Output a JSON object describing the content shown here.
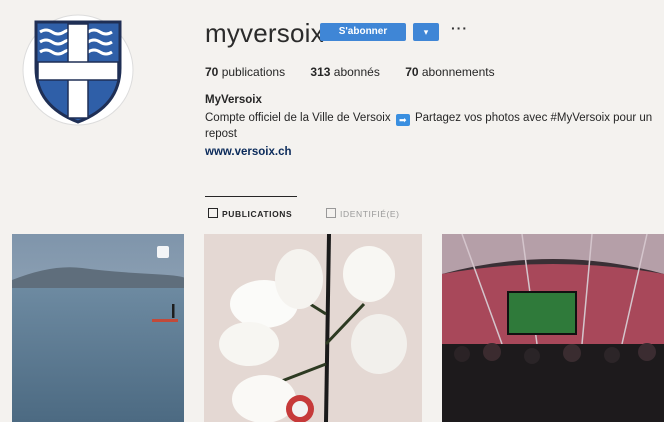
{
  "profile": {
    "username": "myversoix",
    "follow_label": "S'abonner",
    "dropdown_glyph": "▾",
    "more_glyph": "···",
    "stats": {
      "posts": "70",
      "posts_label": " publications",
      "followers": "313",
      "followers_label": " abonnés",
      "following": "70",
      "following_label": " abonnements"
    },
    "bio_name": "MyVersoix",
    "bio_before": "Compte officiel de la Ville de Versoix ",
    "bio_after": " Partagez vos photos avec #MyVersoix pour un repost",
    "website": "www.versoix.ch"
  },
  "tabs": [
    {
      "label": "PUBLICATIONS",
      "active": true
    },
    {
      "label": "IDENTIFIÉ(E)",
      "active": false
    }
  ],
  "icons": {
    "avatar": "coat-of-arms-icon",
    "arrow": "right-arrow-emoji-icon",
    "grid": "grid-icon",
    "tagged": "tagged-icon",
    "multi": "multiple-photos-icon"
  },
  "colors": {
    "accent": "#3f86d6",
    "background": "#f4f2ef"
  }
}
